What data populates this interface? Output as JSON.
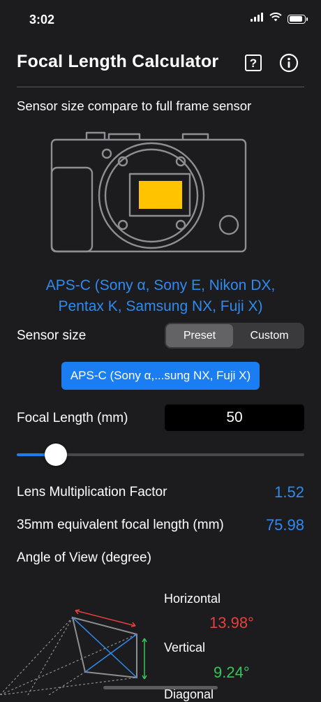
{
  "status": {
    "time": "3:02",
    "battery_level": 0.9
  },
  "header": {
    "title": "Focal Length Calculator",
    "help_icon": "question-square-icon",
    "info_icon": "info-circle-icon"
  },
  "compare": {
    "label": "Sensor size compare to full frame sensor",
    "sensor_color": "#ffc300",
    "sensor_caption_line1": "APS-C (Sony α, Sony E, Nikon DX,",
    "sensor_caption_line2": "Pentax K, Samsung NX, Fuji X)"
  },
  "sensor_size": {
    "label": "Sensor size",
    "options": [
      "Preset",
      "Custom"
    ],
    "selected": "Preset",
    "preset_value": "APS-C (Sony α,...sung NX, Fuji X)"
  },
  "focal_length": {
    "label": "Focal Length (mm)",
    "value": "50",
    "slider_fraction": 0.12
  },
  "results": {
    "lmf_label": "Lens Multiplication Factor",
    "lmf_value": "1.52",
    "equiv_label": "35mm equivalent focal length (mm)",
    "equiv_value": "75.98",
    "aov_label": "Angle of View (degree)",
    "horizontal_label": "Horizontal",
    "horizontal_value": "13.98°",
    "vertical_label": "Vertical",
    "vertical_value": "9.24°",
    "diagonal_label": "Diagonal"
  },
  "colors": {
    "accent": "#1a7ef2",
    "horizontal": "#e8403f",
    "vertical": "#34c759",
    "diagonal": "#2f8bf0"
  }
}
